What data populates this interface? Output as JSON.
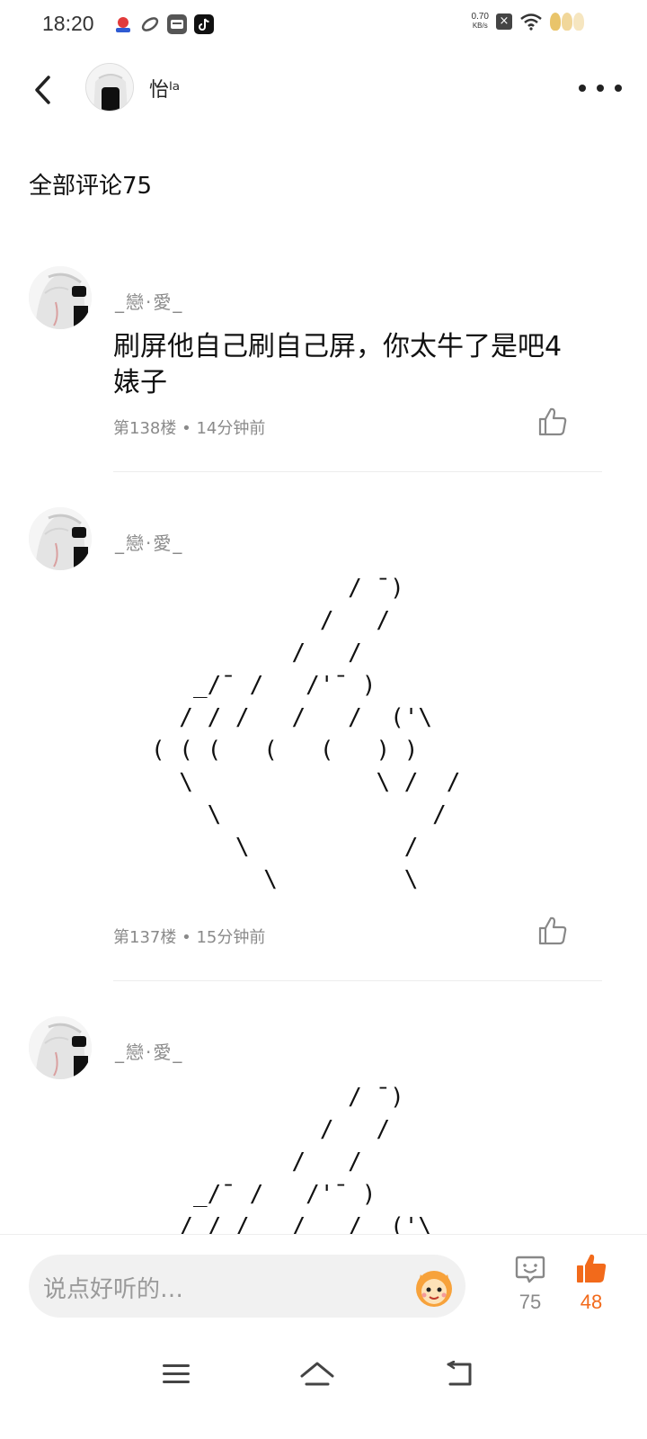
{
  "status_bar": {
    "time": "18:20",
    "net_speed": "0.70",
    "net_unit": "KB/s",
    "icons": [
      "app-icon-1",
      "app-icon-2",
      "app-icon-3",
      "tiktok-icon",
      "close-box-icon",
      "wifi-icon",
      "battery-leaves-icon"
    ]
  },
  "header": {
    "user_name": "怡ˡᵃ",
    "icons": [
      "back-icon",
      "more-icon"
    ]
  },
  "section": {
    "title": "全部评论75"
  },
  "comments": [
    {
      "author": "_戀·愛_",
      "text": "刷屏他自己刷自己屏，你太牛了是吧4婊子",
      "floor": "第138楼",
      "time": "14分钟前"
    },
    {
      "author": "_戀·愛_",
      "ascii": "              / ¯)\n            /   /\n          /   /\n   _/¯ /   /'¯ )\n  / / /   /   /  ('\\\n( ( (   (   (   ) )\n  \\             \\ /  /\n    \\               /\n      \\           /\n        \\         \\",
      "floor": "第137楼",
      "time": "15分钟前"
    },
    {
      "author": "_戀·愛_",
      "ascii": "              / ¯)\n            /   /\n          /   /\n   _/¯ /   /'¯ )\n  / / /   /   /  ('\\"
    }
  ],
  "bottom_bar": {
    "input_placeholder": "说点好听的…",
    "comment_count": "75",
    "like_count": "48",
    "accent_color": "#f26a1b"
  },
  "nav_bar": {
    "icons": [
      "menu-icon",
      "home-icon",
      "back-nav-icon"
    ]
  }
}
